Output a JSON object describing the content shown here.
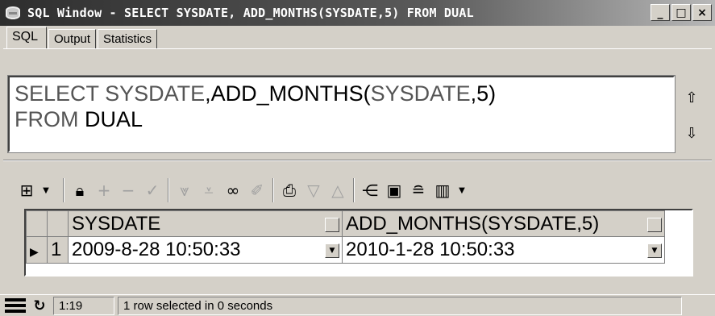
{
  "window": {
    "title": "SQL Window - SELECT SYSDATE, ADD_MONTHS(SYSDATE,5) FROM DUAL",
    "controls": {
      "minimize": "_",
      "maximize": "□",
      "close": "×"
    }
  },
  "tabs": [
    {
      "label": "SQL",
      "active": true
    },
    {
      "label": "Output",
      "active": false
    },
    {
      "label": "Statistics",
      "active": false
    }
  ],
  "editor": {
    "line1": {
      "kw1": "SELECT ",
      "sysdate1": "SYSDATE",
      "mid": ",ADD_MONTHS(",
      "sysdate2": "SYSDATE",
      "end": ",5)"
    },
    "line2": {
      "kw": "FROM ",
      "table": "DUAL"
    },
    "scroll_up": "⇧",
    "scroll_down": "⇩"
  },
  "toolbar": {
    "icons": [
      "grid-icon",
      "lock-icon",
      "plus-icon",
      "minus-icon",
      "check-icon",
      "filter-icon",
      "clear-filter-icon",
      "binoculars-icon",
      "eraser-icon",
      "export-icon",
      "sort-desc-icon",
      "sort-asc-icon",
      "tree-icon",
      "save-icon",
      "database-icon",
      "chart-icon"
    ]
  },
  "grid": {
    "columns": [
      "SYSDATE",
      "ADD_MONTHS(SYSDATE,5)"
    ],
    "rows": [
      {
        "num": "1",
        "cells": [
          "2009-8-28 10:50:33",
          "2010-1-28 10:50:33"
        ]
      }
    ]
  },
  "status": {
    "position": "1:19",
    "message": "1 row selected in 0 seconds"
  }
}
